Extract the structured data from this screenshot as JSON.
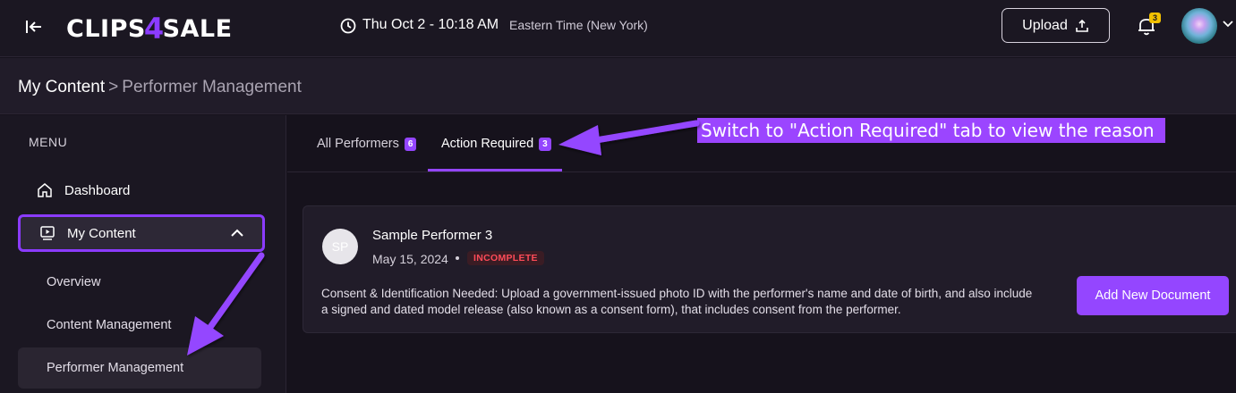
{
  "header": {
    "logo_text_left": "CLIPS",
    "logo_bolt": "4",
    "logo_text_right": "SALE",
    "datetime": "Thu Oct 2 - 10:18 AM",
    "timezone": "Eastern Time (New York)",
    "upload_label": "Upload",
    "notification_count": "3",
    "icons": [
      "collapse-sidebar-icon",
      "clock-icon",
      "upload-icon",
      "bell-icon",
      "avatar",
      "chevron-down-icon"
    ]
  },
  "breadcrumb": {
    "root": "My Content",
    "separator": ">",
    "current": "Performer Management"
  },
  "sidebar": {
    "menu_label": "MENU",
    "items": [
      {
        "label": "Dashboard",
        "icon": "home-icon"
      },
      {
        "label": "My Content",
        "icon": "media-icon",
        "expanded": true
      }
    ],
    "sub_items": [
      {
        "label": "Overview"
      },
      {
        "label": "Content Management"
      },
      {
        "label": "Performer Management",
        "active": true
      }
    ]
  },
  "tabs": [
    {
      "label": "All Performers",
      "count": "6"
    },
    {
      "label": "Action Required",
      "count": "3",
      "active": true
    }
  ],
  "annotation": {
    "text": "Switch to \"Action Required\" tab to view the reason"
  },
  "performer_card": {
    "initials": "SP",
    "name": "Sample Performer 3",
    "date": "May 15, 2024",
    "status": "INCOMPLETE",
    "description": "Consent & Identification Needed: Upload a government-issued photo ID with the performer's name and date of birth, and also include a signed and dated model release (also known as a consent form), that includes consent from the performer.",
    "button_label": "Add New Document"
  },
  "colors": {
    "accent": "#9446ff",
    "callout": "#9b45ff",
    "status_incomplete": "#ff4b58",
    "background": "#16121c"
  }
}
